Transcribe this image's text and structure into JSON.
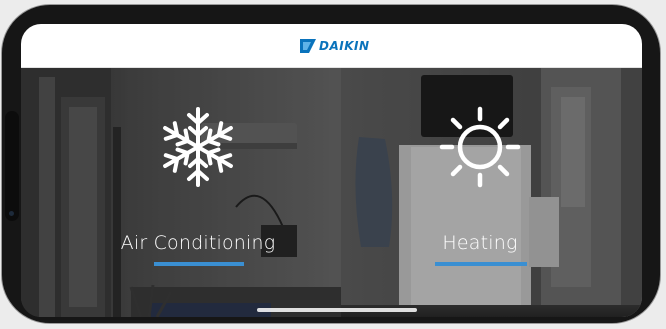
{
  "app": {
    "brand": "DAIKIN"
  },
  "modes": [
    {
      "id": "air-conditioning",
      "label": "Air Conditioning",
      "icon": "snowflake-icon",
      "selected": true
    },
    {
      "id": "heating",
      "label": "Heating",
      "icon": "sun-icon",
      "selected": true
    }
  ],
  "colors": {
    "brand": "#0a73bc",
    "accent_underline": "#3a8fd2",
    "label_text": "#ffffff",
    "header_bg": "#ffffff"
  }
}
